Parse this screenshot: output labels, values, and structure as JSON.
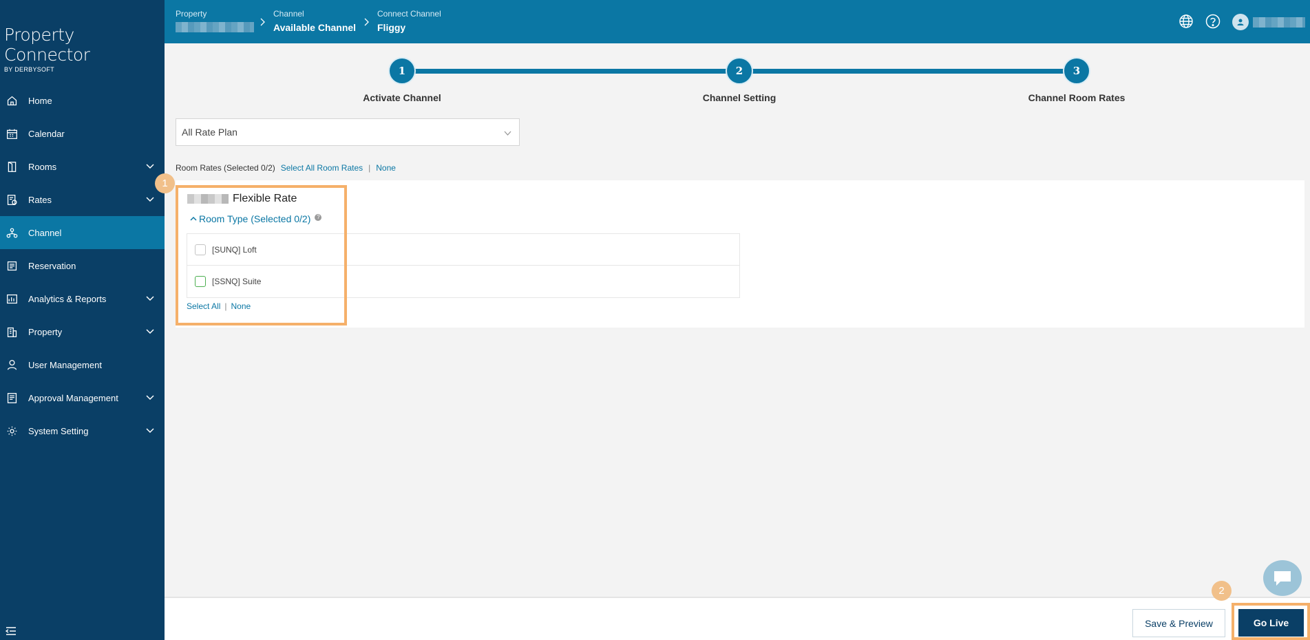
{
  "app": {
    "logo_title": "Property Connector",
    "logo_sub": "BY DERBYSOFT"
  },
  "sidebar": {
    "items": [
      {
        "label": "Home",
        "icon": "home-icon",
        "expandable": false,
        "active": false
      },
      {
        "label": "Calendar",
        "icon": "calendar-icon",
        "expandable": false,
        "active": false
      },
      {
        "label": "Rooms",
        "icon": "door-icon",
        "expandable": true,
        "active": false
      },
      {
        "label": "Rates",
        "icon": "rates-icon",
        "expandable": true,
        "active": false
      },
      {
        "label": "Channel",
        "icon": "channel-icon",
        "expandable": false,
        "active": true
      },
      {
        "label": "Reservation",
        "icon": "reservation-icon",
        "expandable": false,
        "active": false
      },
      {
        "label": "Analytics & Reports",
        "icon": "analytics-icon",
        "expandable": true,
        "active": false
      },
      {
        "label": "Property",
        "icon": "building-icon",
        "expandable": true,
        "active": false
      },
      {
        "label": "User Management",
        "icon": "user-icon",
        "expandable": false,
        "active": false
      },
      {
        "label": "Approval Management",
        "icon": "approval-icon",
        "expandable": true,
        "active": false
      },
      {
        "label": "System Setting",
        "icon": "gear-icon",
        "expandable": true,
        "active": false
      }
    ]
  },
  "header": {
    "breadcrumb": [
      {
        "small": "Property",
        "big": ""
      },
      {
        "small": "Channel",
        "big": "Available Channel"
      },
      {
        "small": "Connect Channel",
        "big": "Fliggy"
      }
    ],
    "icons": [
      "globe-icon",
      "help-icon",
      "avatar"
    ]
  },
  "stepper": {
    "steps": [
      {
        "num": "1",
        "label": "Activate Channel"
      },
      {
        "num": "2",
        "label": "Channel Setting"
      },
      {
        "num": "3",
        "label": "Channel Room Rates"
      }
    ]
  },
  "filters": {
    "rate_plan_select": "All Rate Plan"
  },
  "room_rates": {
    "summary": "Room Rates (Selected 0/2)",
    "select_all": "Select All Room Rates",
    "separator": "|",
    "none": "None"
  },
  "rate_card": {
    "title": "Flexible Rate",
    "room_type_label": "Room Type (Selected 0/2)",
    "info_glyph": "?",
    "rooms": [
      {
        "label": "[SUNQ] Loft",
        "checked": false
      },
      {
        "label": "[SSNQ] Suite",
        "checked": false
      }
    ],
    "select_all": "Select All",
    "separator": "|",
    "none": "None"
  },
  "annotations": {
    "badge_1": "1",
    "badge_2": "2",
    "highlight_color": "#f5b06a"
  },
  "footer": {
    "save_preview": "Save & Preview",
    "go_live": "Go Live"
  },
  "colors": {
    "sidebar": "#0a3f66",
    "header": "#0b77a4",
    "accent": "#0b77a4"
  }
}
